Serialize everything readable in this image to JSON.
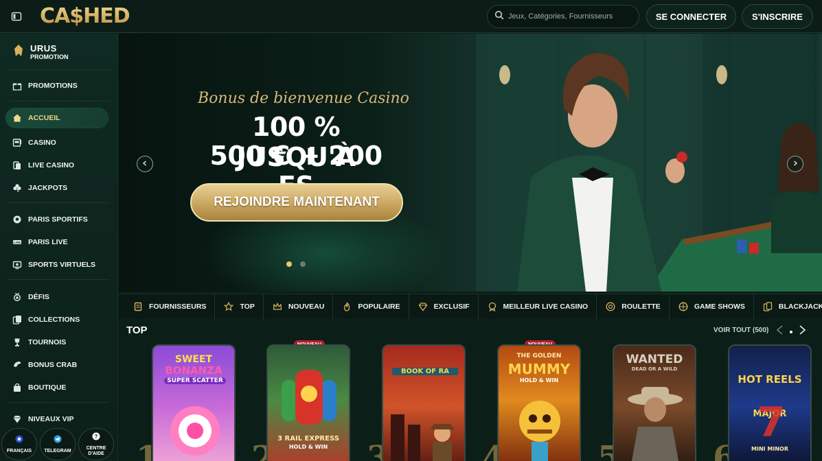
{
  "brand": {
    "logo": "CA$HED"
  },
  "header": {
    "search_placeholder": "Jeux, Catégories, Fournisseurs",
    "login": "SE CONNECTER",
    "signup": "S'INSCRIRE"
  },
  "sidebar": {
    "promo_brand_top": "URUS",
    "promo_brand_bottom": "PROMOTION",
    "items": [
      {
        "label": "PROMOTIONS",
        "icon": "gift-icon"
      },
      {
        "label": "ACCUEIL",
        "icon": "home-icon",
        "active": true
      },
      {
        "label": "CASINO",
        "icon": "slot-machine-icon"
      },
      {
        "label": "LIVE CASINO",
        "icon": "live-cards-icon"
      },
      {
        "label": "JACKPOTS",
        "icon": "clover-icon"
      },
      {
        "label": "PARIS SPORTIFS",
        "icon": "football-icon"
      },
      {
        "label": "PARIS LIVE",
        "icon": "live-badge-icon"
      },
      {
        "label": "SPORTS VIRTUELS",
        "icon": "virtual-screen-icon"
      },
      {
        "label": "DÉFIS",
        "icon": "medal-icon"
      },
      {
        "label": "COLLECTIONS",
        "icon": "collection-icon"
      },
      {
        "label": "TOURNOIS",
        "icon": "trophy-icon"
      },
      {
        "label": "BONUS CRAB",
        "icon": "claw-icon"
      },
      {
        "label": "BOUTIQUE",
        "icon": "shop-bag-icon"
      },
      {
        "label": "NIVEAUX VIP",
        "icon": "diamond-icon"
      }
    ],
    "bottom": [
      {
        "label": "FRANÇAIS",
        "icon": "globe-icon"
      },
      {
        "label": "TELEGRAM",
        "icon": "telegram-icon"
      },
      {
        "label": "CENTRE\nD'AIDE",
        "icon": "help-icon"
      }
    ]
  },
  "hero": {
    "kicker": "Bonus de bienvenue Casino",
    "line1": "100 % JUSQU'À",
    "line2": "500 € + 200 FS",
    "cta": "REJOINDRE MAINTENANT",
    "slides": 2,
    "active_slide": 1
  },
  "categories": [
    {
      "label": "FOURNISSEURS",
      "icon": "provider-icon"
    },
    {
      "label": "TOP",
      "icon": "star-icon"
    },
    {
      "label": "NOUVEAU",
      "icon": "crown-icon"
    },
    {
      "label": "POPULAIRE",
      "icon": "flame-icon"
    },
    {
      "label": "EXCLUSIF",
      "icon": "diamond-icon"
    },
    {
      "label": "MEILLEUR LIVE CASINO",
      "icon": "badge-icon"
    },
    {
      "label": "ROULETTE",
      "icon": "roulette-icon"
    },
    {
      "label": "GAME SHOWS",
      "icon": "wheel-icon"
    },
    {
      "label": "BLACKJACK",
      "icon": "cards-icon"
    }
  ],
  "top_section": {
    "title": "TOP",
    "see_all": "VOIR TOUT (500)",
    "games": [
      {
        "title_a": "SWEET",
        "title_b": "BONANZA",
        "title_c": "SUPER SCATTER",
        "rank": "1",
        "badge": ""
      },
      {
        "title_a": "3 RAIL EXPRESS",
        "title_b": "HOLD & WIN",
        "title_c": "",
        "rank": "2",
        "badge": "NOUVEAU"
      },
      {
        "title_a": "BOOK OF RA",
        "title_b": "",
        "title_c": "",
        "rank": "3",
        "badge": ""
      },
      {
        "title_a": "THE GOLDEN",
        "title_b": "MUMMY",
        "title_c": "HOLD & WIN",
        "rank": "4",
        "badge": "NOUVEAU"
      },
      {
        "title_a": "WANTED",
        "title_b": "DEAD OR A WILD",
        "title_c": "",
        "rank": "5",
        "badge": ""
      },
      {
        "title_a": "HOT REELS",
        "title_b": "MAJOR",
        "title_c": "MINI   MINOR",
        "rank": "6",
        "badge": ""
      }
    ]
  }
}
